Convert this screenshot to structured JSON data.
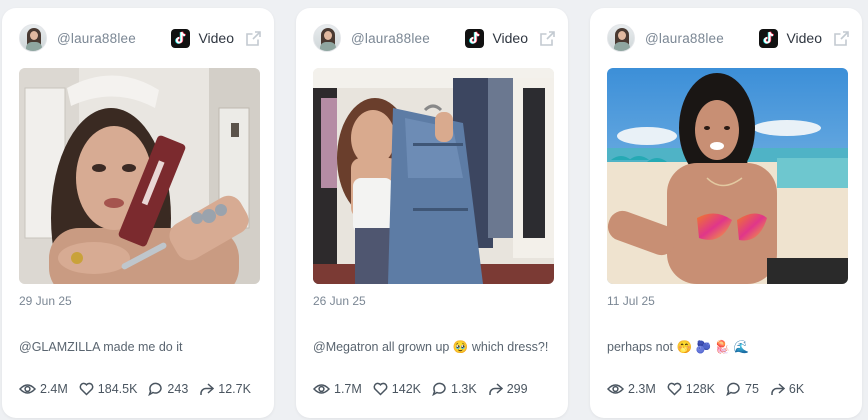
{
  "colors": {
    "background": "#eef0f3",
    "card": "#ffffff",
    "muted_text": "#7b8794",
    "icon_stroke": "#4a5560"
  },
  "cards": [
    {
      "handle": "@laura88lee",
      "platform_label": "Video",
      "platform_icon": "tiktok-icon",
      "date": "29 Jun 25",
      "caption": "@GLAMZILLA made me do it",
      "stats": {
        "views": "2.4M",
        "likes": "184.5K",
        "comments": "243",
        "shares": "12.7K"
      }
    },
    {
      "handle": "@laura88lee",
      "platform_label": "Video",
      "platform_icon": "tiktok-icon",
      "date": "26 Jun 25",
      "caption": "@Megatron all grown up 🥹 which dress?!",
      "stats": {
        "views": "1.7M",
        "likes": "142K",
        "comments": "1.3K",
        "shares": "299"
      }
    },
    {
      "handle": "@laura88lee",
      "platform_label": "Video",
      "platform_icon": "tiktok-icon",
      "date": "11 Jul 25",
      "caption": "perhaps not 🤭 🫐 🪼 🌊",
      "stats": {
        "views": "2.3M",
        "likes": "128K",
        "comments": "75",
        "shares": "6K"
      }
    }
  ]
}
